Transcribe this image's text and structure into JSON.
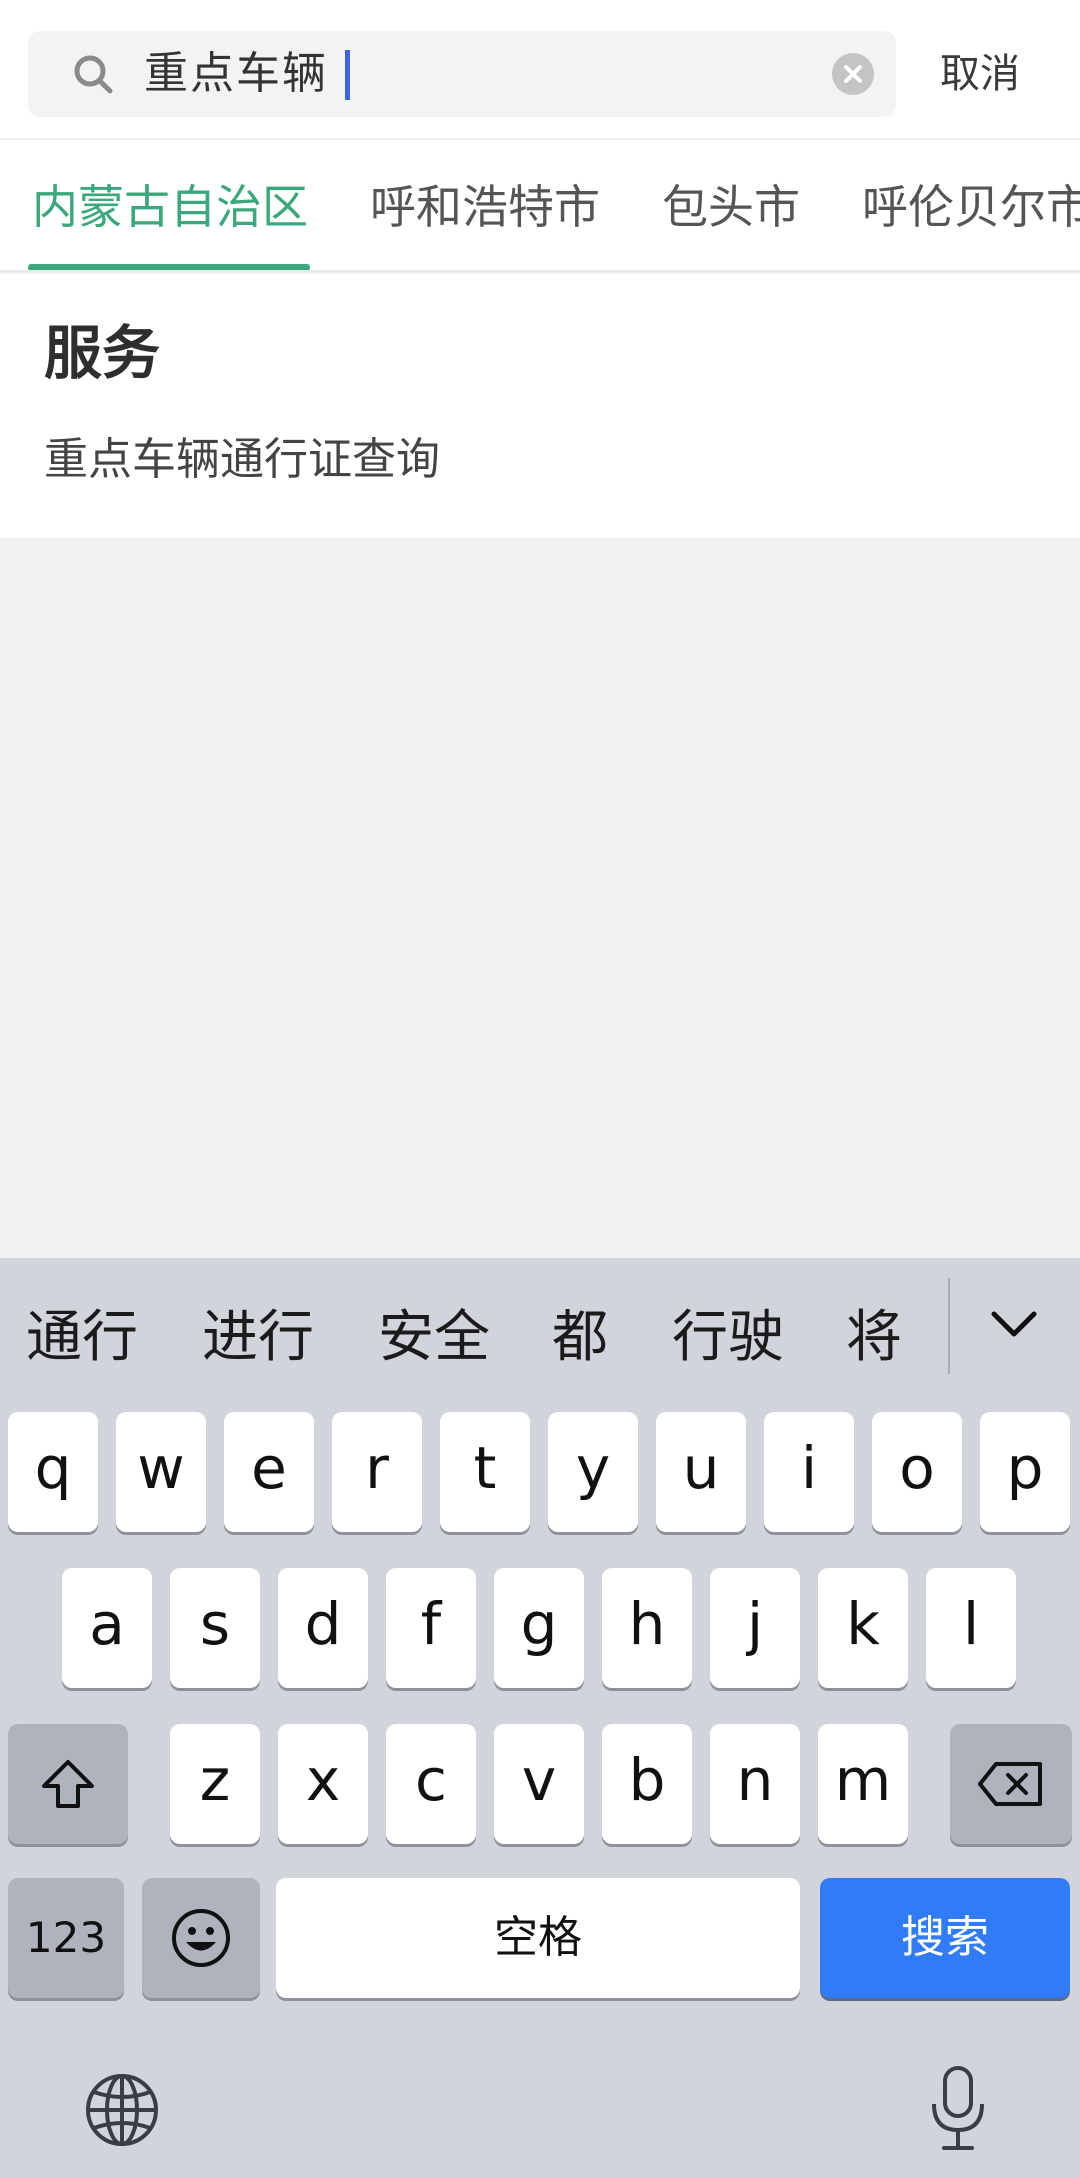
{
  "search": {
    "value": "重点车辆",
    "cancel_label": "取消"
  },
  "tabs": [
    {
      "label": "内蒙古自治区",
      "active": true
    },
    {
      "label": "呼和浩特市",
      "active": false
    },
    {
      "label": "包头市",
      "active": false
    },
    {
      "label": "呼伦贝尔市",
      "active": false
    }
  ],
  "results": {
    "section_title": "服务",
    "items": [
      "重点车辆通行证查询"
    ]
  },
  "keyboard": {
    "candidates": [
      "通行",
      "进行",
      "安全",
      "都",
      "行驶",
      "将"
    ],
    "row1": [
      "q",
      "w",
      "e",
      "r",
      "t",
      "y",
      "u",
      "i",
      "o",
      "p"
    ],
    "row2": [
      "a",
      "s",
      "d",
      "f",
      "g",
      "h",
      "j",
      "k",
      "l"
    ],
    "row3": [
      "z",
      "x",
      "c",
      "v",
      "b",
      "n",
      "m"
    ],
    "numbers_label": "123",
    "space_label": "空格",
    "search_label": "搜索"
  },
  "colors": {
    "accent_green": "#3aa87a",
    "caret_blue": "#3f63e8",
    "search_key_blue": "#2f7cf6"
  },
  "icons": [
    "search-icon",
    "clear-icon",
    "chevron-down-icon",
    "shift-icon",
    "backspace-icon",
    "emoji-icon",
    "globe-icon",
    "microphone-icon"
  ]
}
